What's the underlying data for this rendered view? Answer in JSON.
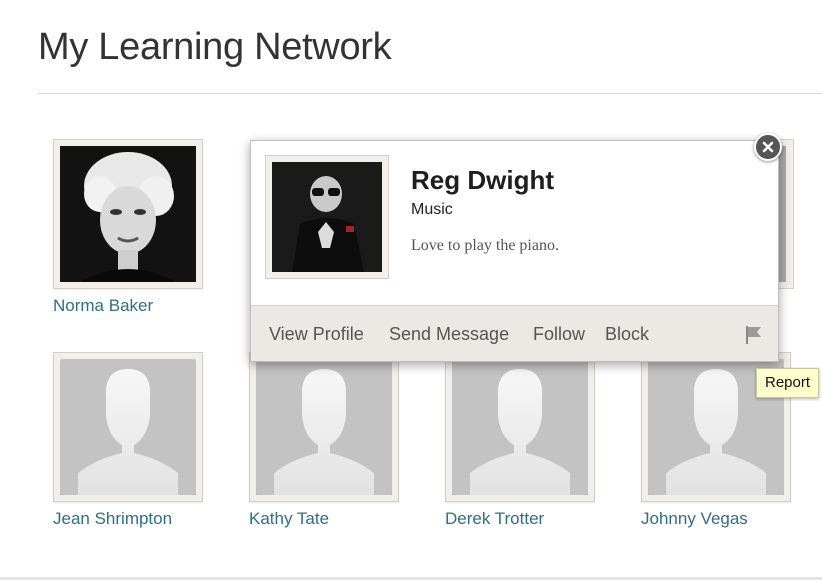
{
  "page": {
    "title": "My Learning Network"
  },
  "network": [
    {
      "name": "Norma Baker",
      "avatar": "photo-woman"
    },
    {
      "name": "Jean Shrimpton",
      "avatar": "placeholder-silhouette"
    },
    {
      "name": "Kathy Tate",
      "avatar": "placeholder-silhouette"
    },
    {
      "name": "Derek Trotter",
      "avatar": "placeholder-silhouette"
    },
    {
      "name": "Johnny Vegas",
      "avatar": "placeholder-silhouette"
    }
  ],
  "popup": {
    "name": "Reg Dwight",
    "subject": "Music",
    "bio": "Love to play the piano.",
    "actions": {
      "view_profile": "View Profile",
      "send_message": "Send Message",
      "follow": "Follow",
      "block": "Block"
    },
    "report_icon": "flag-icon",
    "close_icon": "close-icon"
  },
  "tooltip": {
    "text": "Report"
  },
  "colors": {
    "link": "#2f6f86",
    "action_bar": "#ece9e4",
    "tooltip_bg": "#ffffcc"
  }
}
